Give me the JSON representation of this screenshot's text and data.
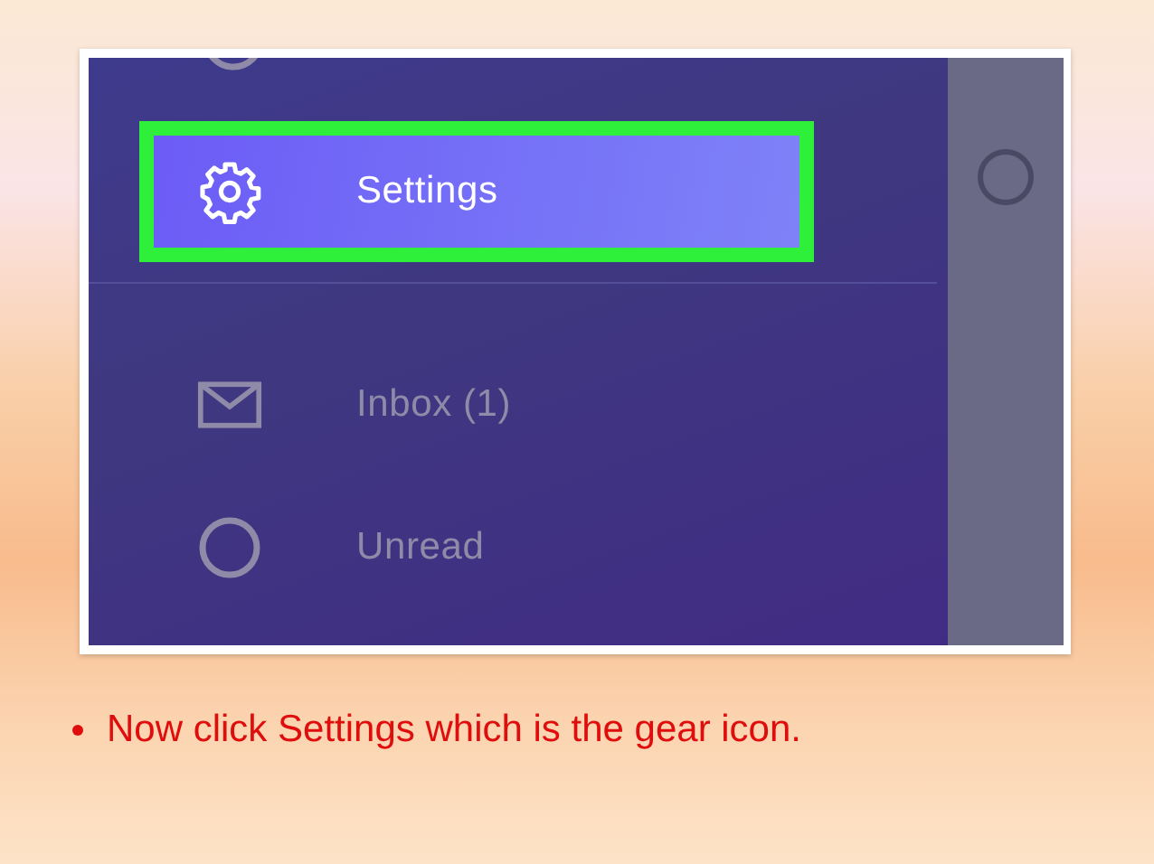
{
  "drawer": {
    "groups": [
      {
        "items": [
          {
            "label": "Settings",
            "kind": "gear",
            "selected": true,
            "annotated": true
          }
        ]
      },
      {
        "items": [
          {
            "label": "Inbox (1)",
            "kind": "mail",
            "selected": false,
            "annotated": false
          },
          {
            "label": "Unread",
            "kind": "circle",
            "selected": false,
            "annotated": false
          }
        ]
      }
    ]
  },
  "side_panel": {
    "radio": {
      "selected": false
    }
  },
  "caption": {
    "text": "Now click Settings which is the gear icon."
  }
}
